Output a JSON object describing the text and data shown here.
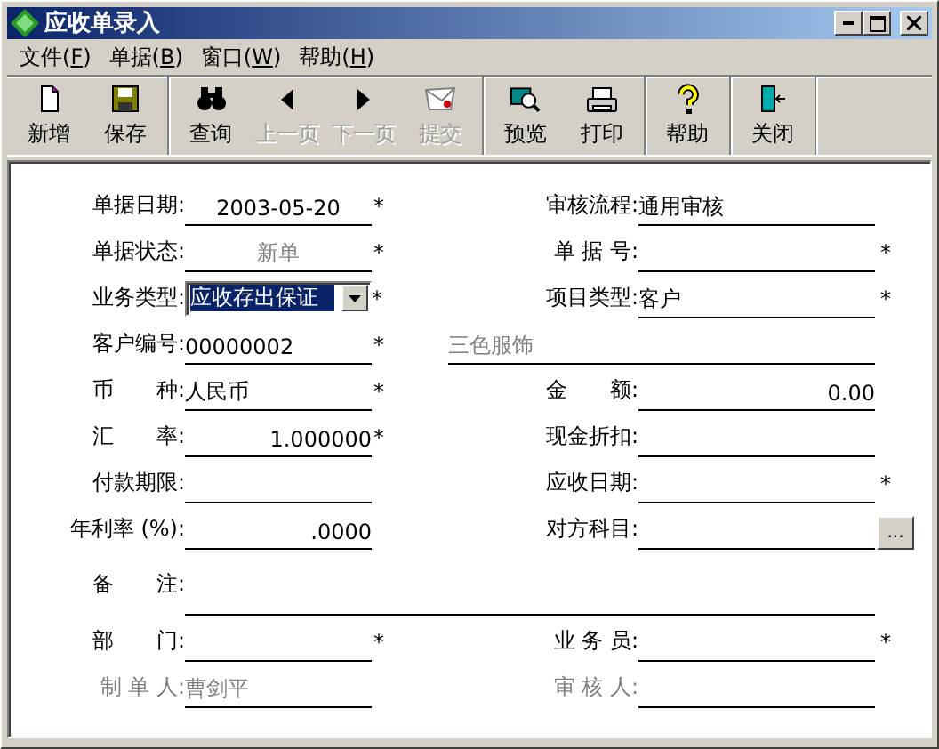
{
  "window": {
    "title": "应收单录入"
  },
  "menu": [
    {
      "label": "文件(F)"
    },
    {
      "label": "单据(B)"
    },
    {
      "label": "窗口(W)"
    },
    {
      "label": "帮助(H)"
    }
  ],
  "toolbar": {
    "groups": [
      {
        "buttons": [
          {
            "label": "新增",
            "disabled": false
          },
          {
            "label": "保存",
            "disabled": false
          }
        ]
      },
      {
        "buttons": [
          {
            "label": "查询",
            "disabled": false
          },
          {
            "label": "上一页",
            "disabled": true
          },
          {
            "label": "下一页",
            "disabled": true
          },
          {
            "label": "提交",
            "disabled": true
          }
        ]
      },
      {
        "buttons": [
          {
            "label": "预览",
            "disabled": false
          },
          {
            "label": "打印",
            "disabled": false
          }
        ]
      },
      {
        "buttons": [
          {
            "label": "帮助",
            "disabled": false
          }
        ]
      },
      {
        "buttons": [
          {
            "label": "关闭",
            "disabled": false
          }
        ]
      }
    ]
  },
  "form": {
    "rows": [
      [
        {
          "kind": "centered",
          "label": "单据日期:",
          "value": "2003-05-20",
          "mark": "*"
        },
        {
          "kind": "text",
          "label": "审核流程:",
          "value": "通用审核"
        }
      ],
      [
        {
          "kind": "centered",
          "label": "单据状态:",
          "value": "新单",
          "mark": "*",
          "readonly": true
        },
        {
          "kind": "text",
          "label": "单 据 号:",
          "mark": "*"
        }
      ],
      [
        {
          "kind": "combo",
          "label": "业务类型:",
          "value": "应收存出保证",
          "mark": "*"
        },
        {
          "kind": "text",
          "label": "项目类型:",
          "value": "客户",
          "mark": "*"
        }
      ],
      [
        {
          "kind": "text",
          "label": "客户编号:",
          "value": "00000002",
          "mark": "*"
        },
        {
          "kind": "display",
          "value": "三色服饰"
        }
      ],
      [
        {
          "kind": "text",
          "label": "币　　种:",
          "value": "人民币",
          "mark": "*"
        },
        {
          "kind": "number",
          "label": "金　　额:",
          "value": "0.00"
        }
      ],
      [
        {
          "kind": "number",
          "label": "汇　　率:",
          "value": "1.000000",
          "mark": "*"
        },
        {
          "kind": "text",
          "label": "现金折扣:"
        }
      ],
      [
        {
          "kind": "text",
          "label": "付款期限:"
        },
        {
          "kind": "text",
          "label": "应收日期:",
          "mark": "*"
        }
      ],
      [
        {
          "kind": "number",
          "label": "年利率 (%):",
          "value": ".0000"
        },
        {
          "kind": "lookup",
          "label": "对方科目:",
          "button": "..."
        }
      ],
      [
        {
          "kind": "memo",
          "label": "备　　注:"
        }
      ],
      [
        {
          "kind": "text",
          "label": "部　　门:",
          "mark": "*"
        },
        {
          "kind": "text",
          "label": "业 务 员:",
          "mark": "*"
        }
      ],
      [
        {
          "kind": "text",
          "label": "制 单 人:",
          "value": "曹剑平",
          "greyed": true
        },
        {
          "kind": "text",
          "label": "审 核 人:",
          "greyed": true
        }
      ]
    ]
  }
}
